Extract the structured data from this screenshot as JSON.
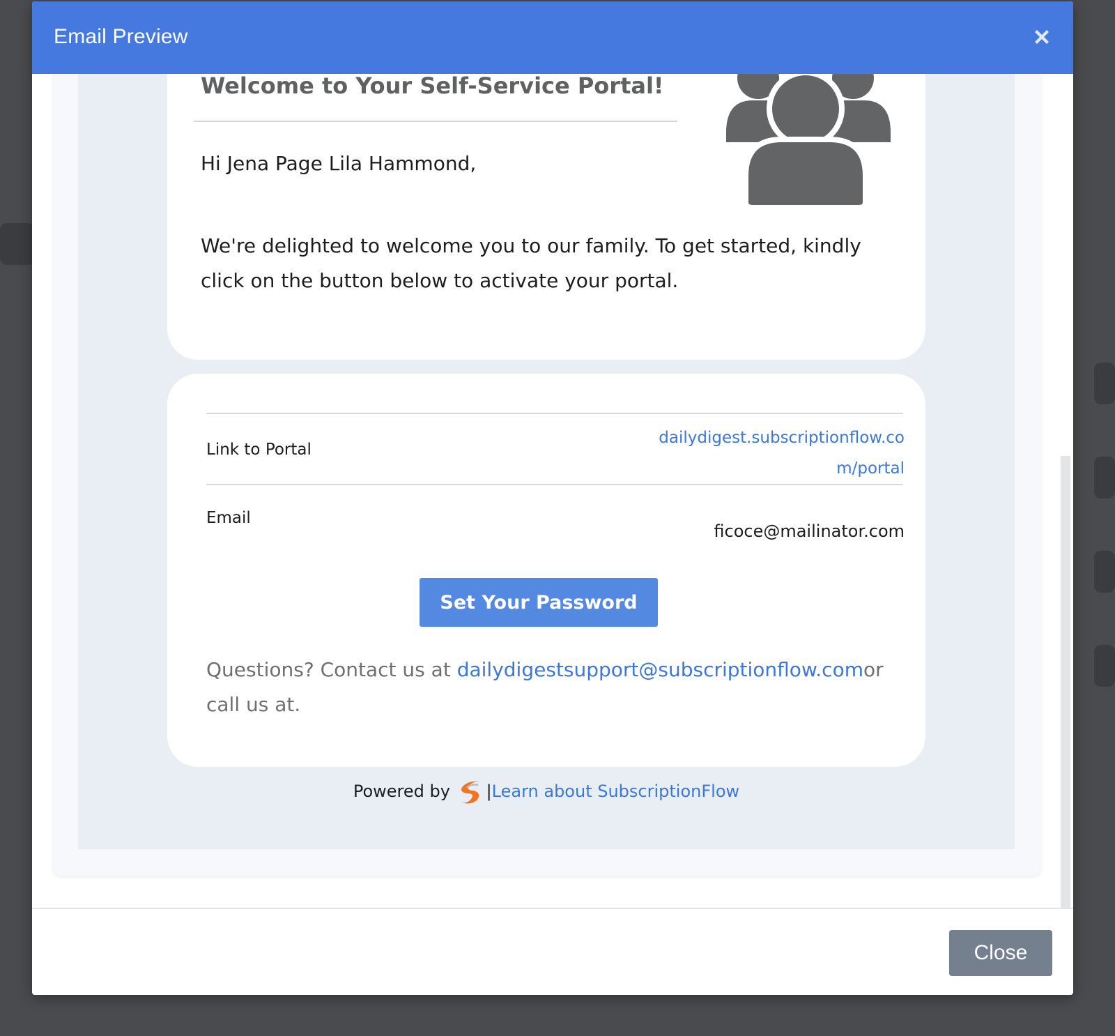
{
  "modal": {
    "title": "Email Preview"
  },
  "email": {
    "welcome_title": "Welcome to Your Self-Service Portal!",
    "greeting": "Hi Jena Page Lila Hammond,",
    "intro": "We're delighted to welcome you to our family. To get started, kindly click on the button below to activate your portal.",
    "portal_label": "Link to Portal",
    "portal_link": "dailydigest.subscriptionflow.com/portal",
    "email_label": "Email",
    "email_value": "ficoce@mailinator.com",
    "set_password_label": "Set Your Password",
    "questions_prefix": "Questions? Contact us at ",
    "support_email": "dailydigestsupport@subscriptionflow.com",
    "questions_suffix": "or call us at.",
    "powered_by": "Powered by ",
    "powered_separator": "|",
    "learn_link": "Learn about SubscriptionFlow"
  },
  "footer": {
    "close_label": "Close"
  },
  "colors": {
    "header": "#4579e0",
    "link": "#3b78d8",
    "primary_button": "#5389e0",
    "close_button": "#75808f",
    "logo_orange": "#f07426"
  },
  "icons": {
    "close": "close-x-icon",
    "people": "users-group-icon",
    "logo": "subscriptionflow-logo-icon"
  }
}
